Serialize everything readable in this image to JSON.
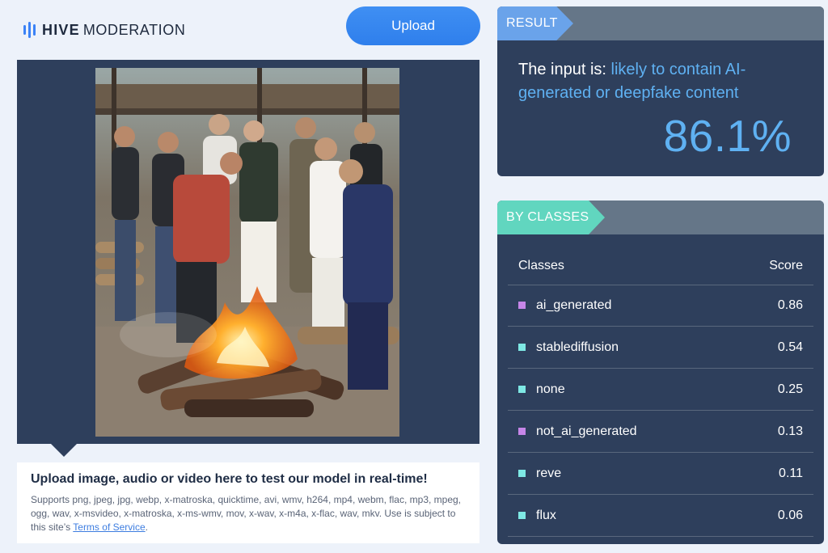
{
  "header": {
    "logo_bold": "HIVE",
    "logo_light": "MODERATION",
    "upload_label": "Upload"
  },
  "upload_info": {
    "title": "Upload image, audio or video here to test our model in real-time!",
    "description": "Supports png, jpeg, jpg, webp, x-matroska, quicktime, avi, wmv, h264, mp4, webm, flac, mp3, mpeg, ogg, wav, x-msvideo, x-matroska, x-ms-wmv, mov, x-wav, x-m4a, x-flac, wav, mkv. Use is subject to this site’s",
    "terms_link": "Terms of Service",
    "trailing": "."
  },
  "result": {
    "tag": "RESULT",
    "prefix": "The input is: ",
    "verdict": "likely to contain AI-generated or deepfake content",
    "percentage": "86.1%"
  },
  "classes": {
    "tag": "BY CLASSES",
    "col_class": "Classes",
    "col_score": "Score",
    "rows": [
      {
        "name": "ai_generated",
        "score": "0.86",
        "color": "#c686e8"
      },
      {
        "name": "stablediffusion",
        "score": "0.54",
        "color": "#7ee8e4"
      },
      {
        "name": "none",
        "score": "0.25",
        "color": "#7ee8e4"
      },
      {
        "name": "not_ai_generated",
        "score": "0.13",
        "color": "#c686e8"
      },
      {
        "name": "reve",
        "score": "0.11",
        "color": "#7ee8e4"
      },
      {
        "name": "flux",
        "score": "0.06",
        "color": "#7ee8e4"
      }
    ]
  },
  "colors": {
    "accent_blue": "#3b82f6",
    "result_tag": "#6aa3ea",
    "classes_tag": "#61d6bf",
    "card_bg": "#2e3f5c",
    "highlight": "#5fb1f2"
  }
}
